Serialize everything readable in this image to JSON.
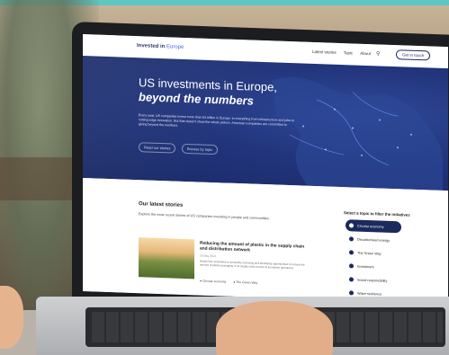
{
  "nav": {
    "logo_main": "Invested in",
    "logo_accent": "Europe",
    "items": [
      "Latest stories",
      "Topic",
      "About"
    ],
    "search_icon": "search-icon",
    "cta": "Get in touch"
  },
  "hero": {
    "title_line1": "US investments in Europe,",
    "title_line2": "beyond the numbers",
    "body": "Every year, US companies invest more than €3 trillion in Europe. In everything from infrastructure and jobs to cutting-edge innovation. But that doesn't show the whole picture. American companies are committed to giving beyond the numbers.",
    "btn_primary": "Read our stories",
    "btn_secondary": "Browse by topic"
  },
  "stories": {
    "title": "Our latest stories",
    "subtitle": "Explore the most recent stories of US companies investing in people and communities.",
    "featured": {
      "title": "Reducing the amount of plastic in the supply chain and distribution network",
      "date": "20 May 2021",
      "body": "Nestlé has committed to constantly reviewing and identifying opportunities to reduce the amount of plastic packaging in its supply chain across its European operations.",
      "tags": [
        "Circular economy",
        "The Green Way"
      ]
    }
  },
  "filter": {
    "title": "Select a topic to filter the initiatives",
    "items": [
      {
        "label": "Circular economy",
        "active": true
      },
      {
        "label": "Decarbonised energy",
        "active": false
      },
      {
        "label": "The Green Way",
        "active": false
      },
      {
        "label": "Investment",
        "active": false
      },
      {
        "label": "Social responsibility",
        "active": false
      },
      {
        "label": "Water resilience",
        "active": false
      }
    ]
  },
  "colors": {
    "navy": "#1b2a5c",
    "hero_blue": "#22357c",
    "accent_teal": "#5fc7c2"
  }
}
